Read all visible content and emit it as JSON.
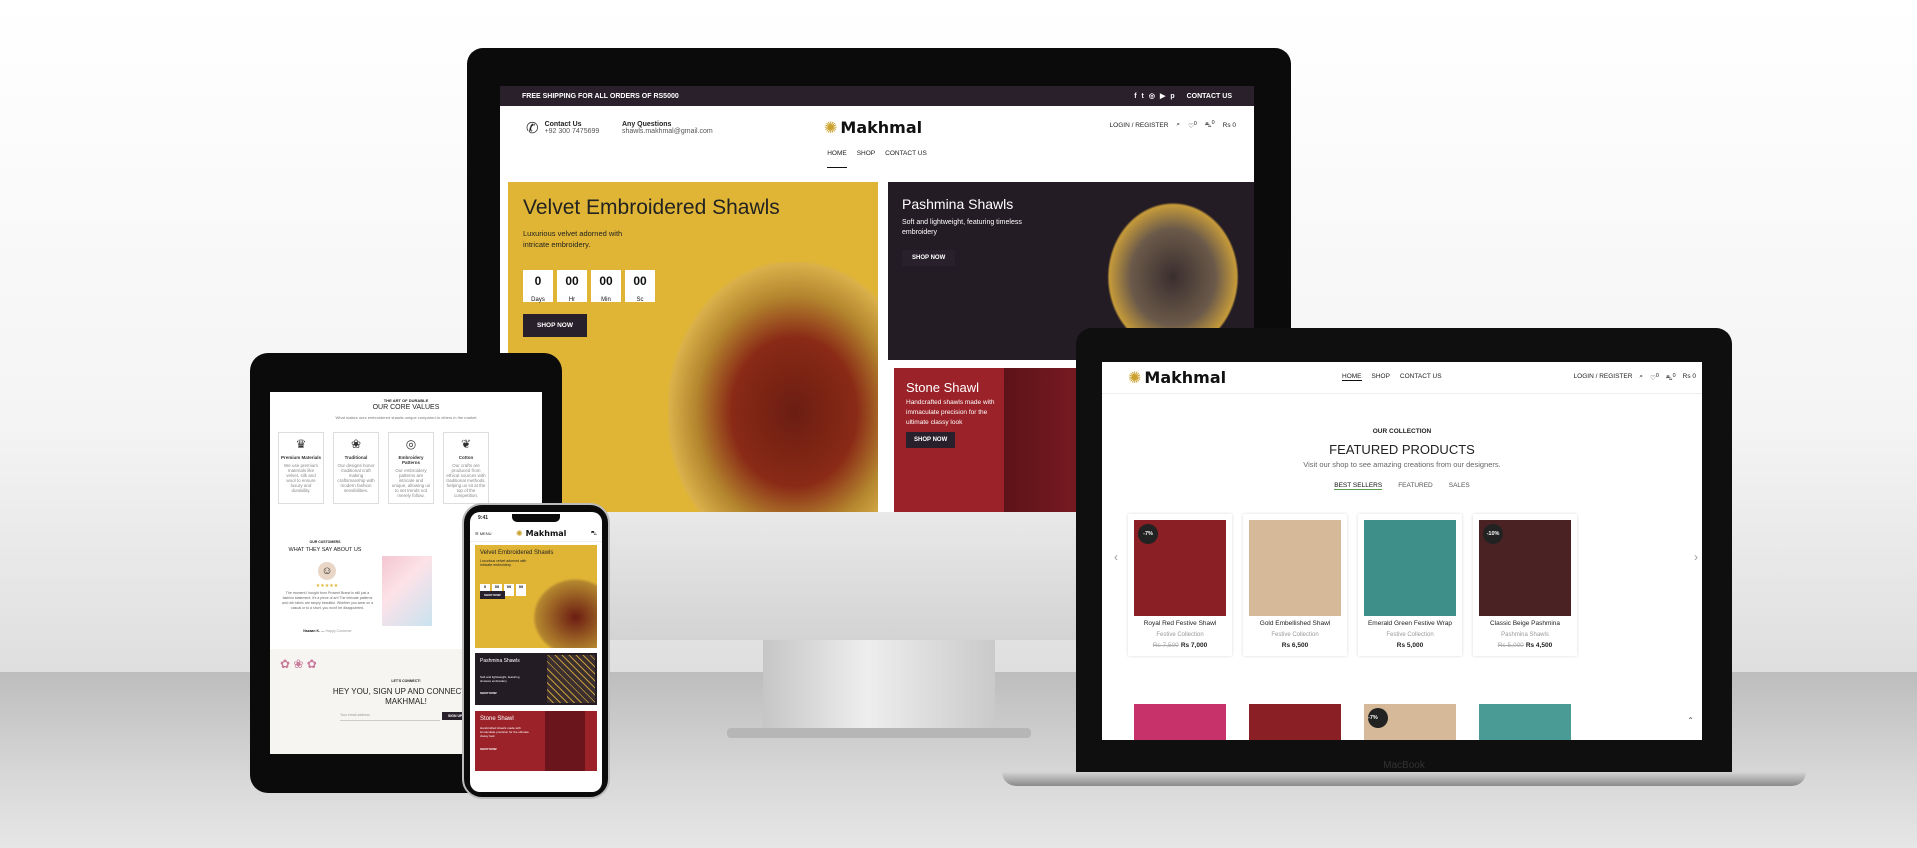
{
  "brand": {
    "name": "Makhmal",
    "accent": "#e0b535",
    "dark": "#29202b",
    "red": "#9a2228"
  },
  "imac": {
    "topbar": {
      "shipping": "FREE SHIPPING FOR ALL ORDERS OF RS5000",
      "contact": "CONTACT US"
    },
    "contact": {
      "label": "Contact Us",
      "phone": "+92 300 7475699"
    },
    "questions": {
      "label": "Any Questions",
      "email": "shawls.makhmal@gmail.com"
    },
    "header": {
      "login": "LOGIN / REGISTER",
      "cart": "Rs 0",
      "wish_count": "0",
      "cart_count": "0"
    },
    "nav": [
      "HOME",
      "SHOP",
      "CONTACT US"
    ],
    "banner1": {
      "title": "Velvet Embroidered Shawls",
      "sub": "Luxurious velvet adorned with intricate embroidery.",
      "button": "SHOP NOW",
      "countdown": [
        {
          "v": "0",
          "u": "Days"
        },
        {
          "v": "00",
          "u": "Hr"
        },
        {
          "v": "00",
          "u": "Min"
        },
        {
          "v": "00",
          "u": "Sc"
        }
      ]
    },
    "banner2": {
      "title": "Pashmina Shawls",
      "sub": "Soft and lightweight, featuring timeless embroidery",
      "button": "SHOP NOW"
    },
    "banner3": {
      "title": "Stone Shawl",
      "sub": "Handcrafted shawls made with immaculate precision for the ultimate classy look",
      "button": "SHOP NOW"
    }
  },
  "laptop": {
    "label": "MacBook",
    "nav": [
      "HOME",
      "SHOP",
      "CONTACT US"
    ],
    "header": {
      "login": "LOGIN / REGISTER",
      "cart": "Rs 0",
      "wish_count": "0",
      "cart_count": "0"
    },
    "eyebrow": "OUR COLLECTION",
    "title": "FEATURED PRODUCTS",
    "subtitle": "Visit our shop to see amazing creations from our designers.",
    "tabs": [
      "BEST SELLERS",
      "FEATURED",
      "SALES"
    ],
    "products": [
      {
        "name": "Royal Red Festive Shawl",
        "cat": "Festive Collection",
        "old": "Rs 7,500",
        "price": "Rs 7,000",
        "badge": "-7%",
        "color": "#8a1f26"
      },
      {
        "name": "Gold Embellished Shawl",
        "cat": "Festive Collection",
        "old": "",
        "price": "Rs 6,500",
        "badge": "",
        "color": "#d6b998"
      },
      {
        "name": "Emerald Green Festive Wrap",
        "cat": "Festive Collection",
        "old": "",
        "price": "Rs 5,000",
        "badge": "",
        "color": "#3e8f8a"
      },
      {
        "name": "Classic Beige Pashmina",
        "cat": "Pashmina Shawls",
        "old": "Rs 5,000",
        "price": "Rs 4,500",
        "badge": "-10%",
        "color": "#4a2224"
      }
    ],
    "row2_badge": "-7%"
  },
  "tablet": {
    "eyebrow": "THE ART OF DURABLE",
    "title": "OUR CORE VALUES",
    "subtitle": "What makes ours embroidered shawls unique compared to others in the market",
    "values": [
      {
        "icon": "crown-icon",
        "glyph": "♛",
        "title": "Premium Materials",
        "text": "We use premium materials like velvet, silk and wool to ensure luxury and durability."
      },
      {
        "icon": "flower-icon",
        "glyph": "❀",
        "title": "Traditional",
        "text": "Our designs honor traditional craft making craftsmanship with modern fashion sensibilities."
      },
      {
        "icon": "pattern-icon",
        "glyph": "◎",
        "title": "Embroidery Patterns",
        "text": "Our embroidery patterns are intricate and unique, allowing us to set trends not merely follow."
      },
      {
        "icon": "cotton-icon",
        "glyph": "❦",
        "title": "Cotton",
        "text": "Our crafts are produced from ethical sources with traditional methods, helping us sit at the top of the competition."
      }
    ],
    "testimonials": {
      "eyebrow": "OUR CUSTOMERS",
      "title": "WHAT THEY SAY ABOUT US",
      "stars": "★★★★★",
      "quote": "The moment I bought from Prosent Brand is still just a fashion statement, it's a piece of art! The intricate patterns and rich fabric are simply beautiful. Whether you wear on a casual or to a short, you won't be disappointed.",
      "author": "Nazaan K.",
      "role": "Happy Customer"
    },
    "signup": {
      "eyebrow": "LET'S CONNECT!",
      "title": "HEY YOU, SIGN UP AND CONNECT TO MAKHMAL!",
      "placeholder": "Your email address",
      "button": "SIGN UP"
    }
  },
  "phone": {
    "time": "9:41",
    "menu": "MENU",
    "banner1": {
      "title": "Velvet Embroidered Shawls",
      "sub": "Luxurious velvet adorned with intricate embroidery.",
      "button": "SHOP NOW",
      "countdown": [
        {
          "v": "0",
          "u": "Days"
        },
        {
          "v": "00",
          "u": "Hr"
        },
        {
          "v": "00",
          "u": "Min"
        },
        {
          "v": "00",
          "u": "Sc"
        }
      ]
    },
    "banner2": {
      "title": "Pashmina Shawls",
      "sub": "Soft and lightweight, featuring timeless embroidery",
      "button": "SHOP NOW"
    },
    "banner3": {
      "title": "Stone Shawl",
      "sub": "Handcrafted shawls made with immaculate precision for the ultimate classy look",
      "button": "SHOP NOW"
    }
  }
}
